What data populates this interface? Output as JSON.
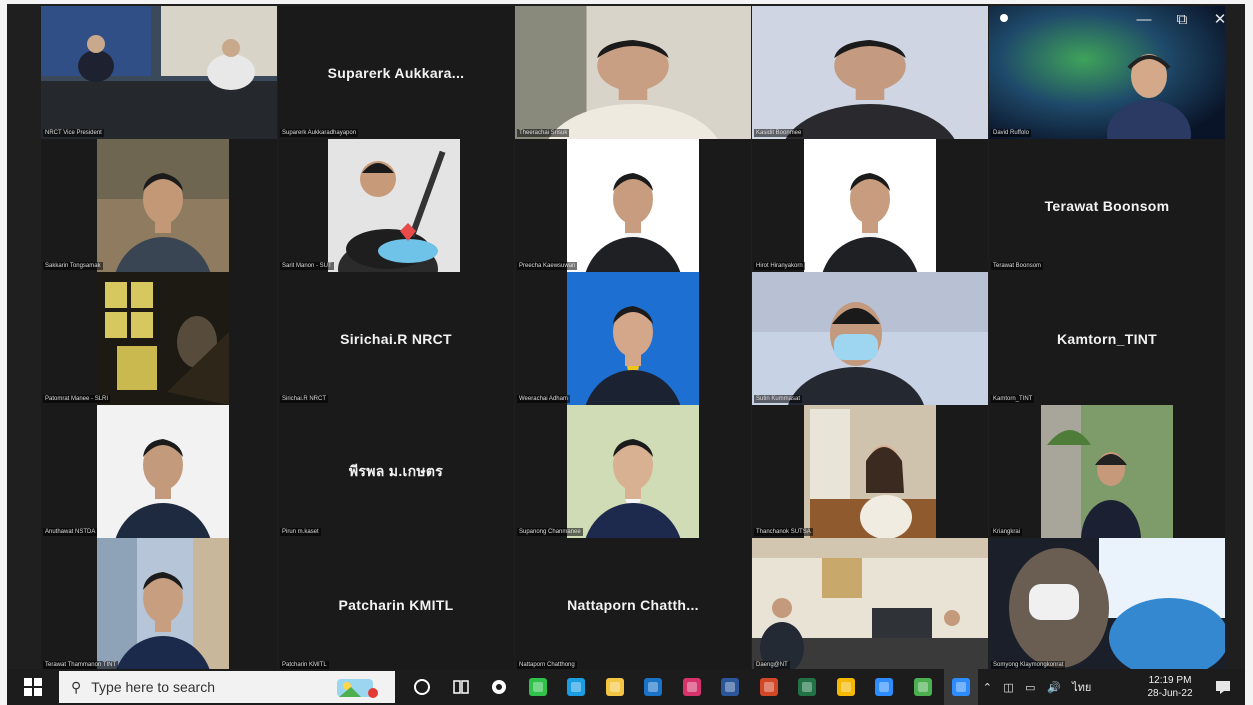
{
  "window": {
    "minimize_icon": "minimize-icon",
    "restore_icon": "restore-icon",
    "close_icon": "close-icon"
  },
  "participants": [
    {
      "caption": "NRCT Vice President",
      "center_name": "",
      "video": "meeting-room"
    },
    {
      "caption": "Suparerk Aukkaradhayapon",
      "center_name": "Suparerk  Aukkara...",
      "video": ""
    },
    {
      "caption": "Theerachai Srisuk",
      "center_name": "",
      "video": "man-glasses-office"
    },
    {
      "caption": "Kasidit Boonmee",
      "center_name": "",
      "video": "man-glasses-light"
    },
    {
      "caption": "David Ruffolo",
      "center_name": "",
      "video": "space-background"
    },
    {
      "caption": "Sakkarin Tongsamak",
      "center_name": "",
      "video": "man-outdoor"
    },
    {
      "caption": "Sarit Manon - SUT",
      "center_name": "",
      "video": "guitar-photo"
    },
    {
      "caption": "Preecha Kaewsuwan",
      "center_name": "",
      "video": "man-suit-white"
    },
    {
      "caption": "Hirot Hiranyakorn",
      "center_name": "",
      "video": "man-suit-white"
    },
    {
      "caption": "Terawat  Boonsom",
      "center_name": "Terawat  Boonsom",
      "video": ""
    },
    {
      "caption": "Patomrat Manee - SLRI",
      "center_name": "",
      "video": "artistic-window"
    },
    {
      "caption": "Sirichai.R  NRCT",
      "center_name": "Sirichai.R  NRCT",
      "video": ""
    },
    {
      "caption": "Weerachai Adham",
      "center_name": "",
      "video": "man-suit-blue"
    },
    {
      "caption": "Sutin Kummasat",
      "center_name": "",
      "video": "man-mask"
    },
    {
      "caption": "Kamtorn_TINT",
      "center_name": "Kamtorn_TINT",
      "video": ""
    },
    {
      "caption": "Anuthawat NSTDA",
      "center_name": "",
      "video": "man-dark-shirt"
    },
    {
      "caption": "Pirun m.kaset",
      "center_name": "พีรพล ม.เกษตร",
      "video": ""
    },
    {
      "caption": "Supanong Chanmanee",
      "center_name": "",
      "video": "man-smile-green"
    },
    {
      "caption": "Thanchanok SUTSA",
      "center_name": "",
      "video": "woman-window"
    },
    {
      "caption": "Kriangkrai",
      "center_name": "",
      "video": "woman-garden"
    },
    {
      "caption": "Terawat Thammanon TINT",
      "center_name": "",
      "video": "man-city"
    },
    {
      "caption": "Patcharin KMITL",
      "center_name": "Patcharin KMITL",
      "video": ""
    },
    {
      "caption": "Nattaporn Chatthong",
      "center_name": "Nattaporn  Chatth...",
      "video": ""
    },
    {
      "caption": "Daeng@NT",
      "center_name": "",
      "video": "office-group"
    },
    {
      "caption": "Somyong Klaymongkonrat",
      "center_name": "",
      "video": "woman-mask-car"
    }
  ],
  "taskbar": {
    "search_placeholder": "Type here to search",
    "apps": [
      {
        "name": "cortana-icon",
        "color": "#ffffff"
      },
      {
        "name": "task-view-icon",
        "color": "#ffffff"
      },
      {
        "name": "settings-gear-icon",
        "color": "#ffffff"
      },
      {
        "name": "line-app-icon",
        "color": "#2fc14a"
      },
      {
        "name": "edge-browser-icon",
        "color": "#1b9de2"
      },
      {
        "name": "file-explorer-icon",
        "color": "#f4c542"
      },
      {
        "name": "outlook-icon",
        "color": "#1a73c7"
      },
      {
        "name": "media-player-icon",
        "color": "#d6336c"
      },
      {
        "name": "word-icon",
        "color": "#2b579a"
      },
      {
        "name": "powerpoint-icon",
        "color": "#d24726"
      },
      {
        "name": "excel-icon",
        "color": "#217346"
      },
      {
        "name": "python-icon",
        "color": "#f5b800"
      },
      {
        "name": "zoom-meeting-icon",
        "color": "#2d8cff"
      },
      {
        "name": "green-app-icon",
        "color": "#4caf50"
      },
      {
        "name": "active-app-icon",
        "color": "#2d8cff"
      }
    ],
    "tray_language": "ไทย",
    "time": "12:19 PM",
    "date": "28-Jun-22"
  }
}
